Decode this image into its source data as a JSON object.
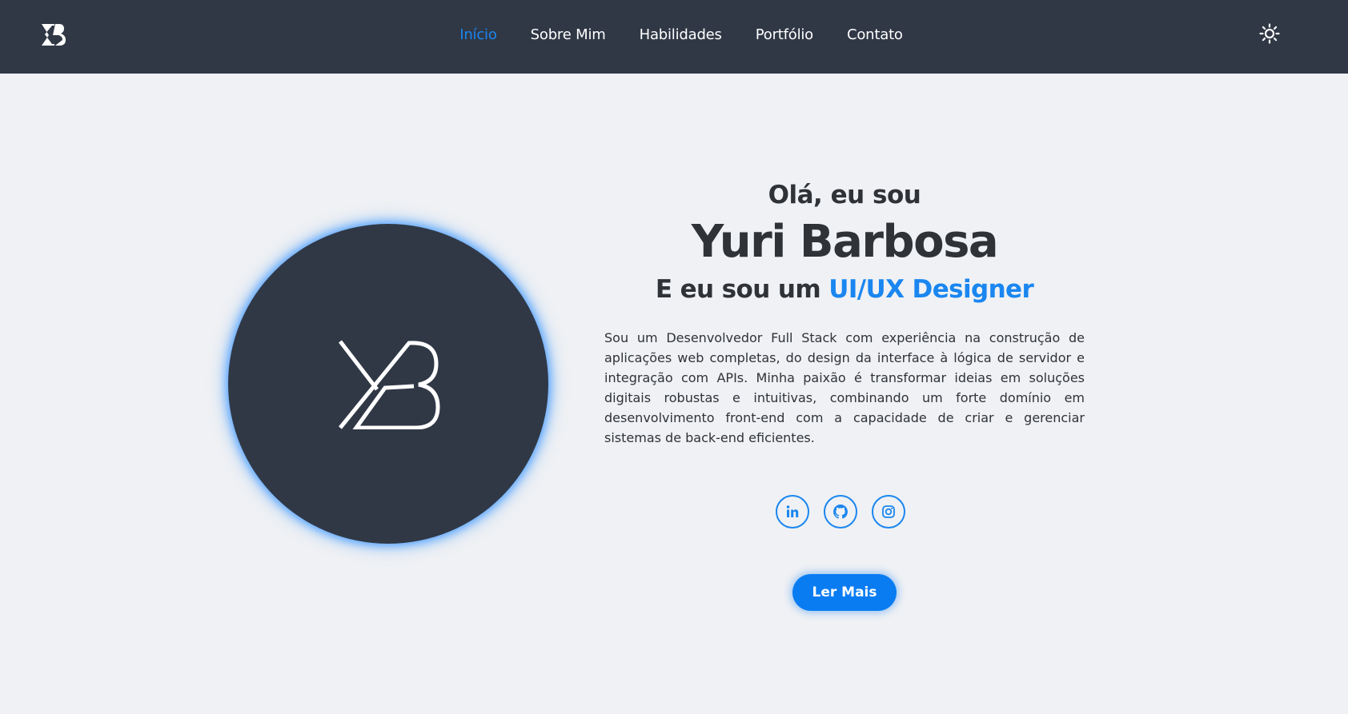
{
  "header": {
    "logo_icon": "yb-logo-icon",
    "nav": [
      {
        "label": "Início",
        "active": true
      },
      {
        "label": "Sobre Mim",
        "active": false
      },
      {
        "label": "Habilidades",
        "active": false
      },
      {
        "label": "Portfólio",
        "active": false
      },
      {
        "label": "Contato",
        "active": false
      }
    ],
    "theme_toggle_icon": "sun-icon"
  },
  "hero": {
    "greeting": "Olá, eu sou",
    "name": "Yuri Barbosa",
    "role_prefix": "E eu sou um ",
    "role_highlight": "UI/UX Designer",
    "bio": "Sou um Desenvolvedor Full Stack com experiência na construção de aplicações web completas, do design da interface à lógica de servidor e integração com APIs. Minha paixão é transformar ideias em soluções digitais robustas e intuitivas, combinando um forte domínio em desenvolvimento front-end com a capacidade de criar e gerenciar sistemas de back-end eficientes.",
    "socials": [
      {
        "icon": "linkedin-icon"
      },
      {
        "icon": "github-icon"
      },
      {
        "icon": "instagram-icon"
      }
    ],
    "cta_label": "Ler Mais",
    "avatar_icon": "yb-monogram-icon"
  },
  "colors": {
    "header_bg": "#303846",
    "page_bg": "#eff1f4",
    "accent": "#1a86f0",
    "text": "#2f3237"
  }
}
